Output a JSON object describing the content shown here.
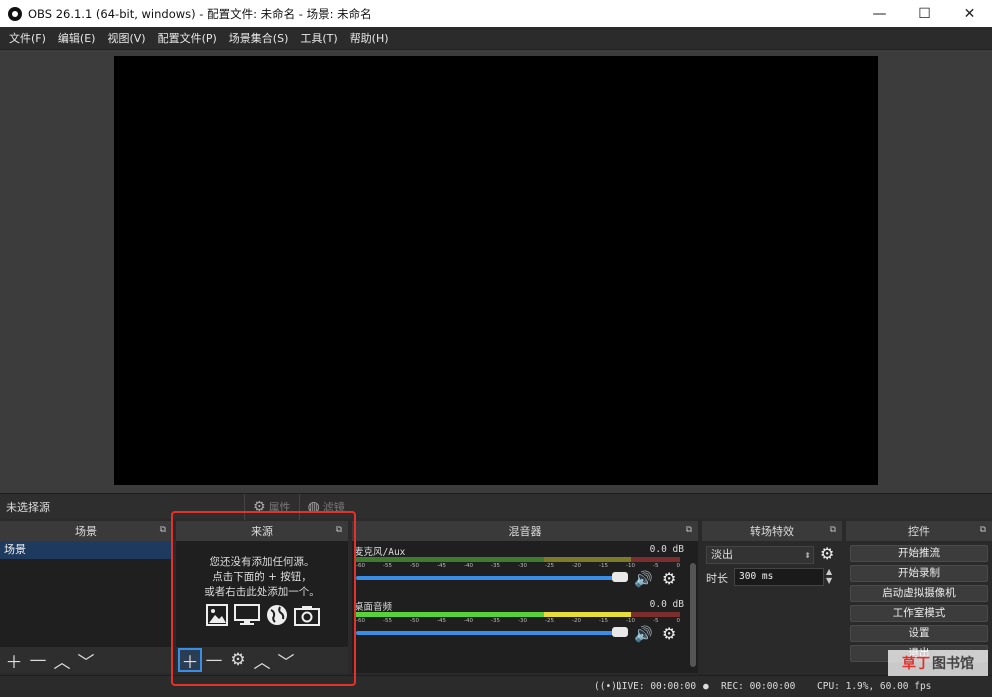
{
  "window": {
    "title": "OBS 26.1.1 (64-bit, windows) - 配置文件: 未命名 - 场景: 未命名",
    "minimize": "—",
    "maximize": "☐",
    "close": "✕"
  },
  "menu": [
    "文件(F)",
    "编辑(E)",
    "视图(V)",
    "配置文件(P)",
    "场景集合(S)",
    "工具(T)",
    "帮助(H)"
  ],
  "source_toolbar": {
    "no_source": "未选择源",
    "properties": "属性",
    "filters": "滤镜"
  },
  "scenes": {
    "title": "场景",
    "items": [
      "场景"
    ]
  },
  "sources": {
    "title": "来源",
    "empty_line1": "您还没有添加任何源。",
    "empty_line2": "点击下面的 + 按钮，",
    "empty_line3": "或者右击此处添加一个。"
  },
  "mixer": {
    "title": "混音器",
    "ticks": [
      "-60",
      "-55",
      "-50",
      "-45",
      "-40",
      "-35",
      "-30",
      "-25",
      "-20",
      "-15",
      "-10",
      "-5",
      "0"
    ],
    "channels": [
      {
        "name": "麦克风/Aux",
        "db": "0.0 dB",
        "active": false
      },
      {
        "name": "桌面音频",
        "db": "0.0 dB",
        "active": true
      }
    ]
  },
  "transitions": {
    "title": "转场特效",
    "selected": "淡出",
    "duration_label": "时长",
    "duration_value": "300 ms"
  },
  "controls": {
    "title": "控件",
    "buttons": [
      "开始推流",
      "开始录制",
      "启动虚拟摄像机",
      "工作室模式",
      "设置",
      "退出"
    ]
  },
  "status": {
    "live": "LIVE: 00:00:00",
    "rec": "REC: 00:00:00",
    "cpu": "CPU: 1.9%, 60.00 fps"
  },
  "watermark": {
    "part1": "草丁",
    "part2": "图书馆"
  },
  "colors": {
    "highlight": "#e0332e",
    "accent": "#3a8ee6"
  }
}
